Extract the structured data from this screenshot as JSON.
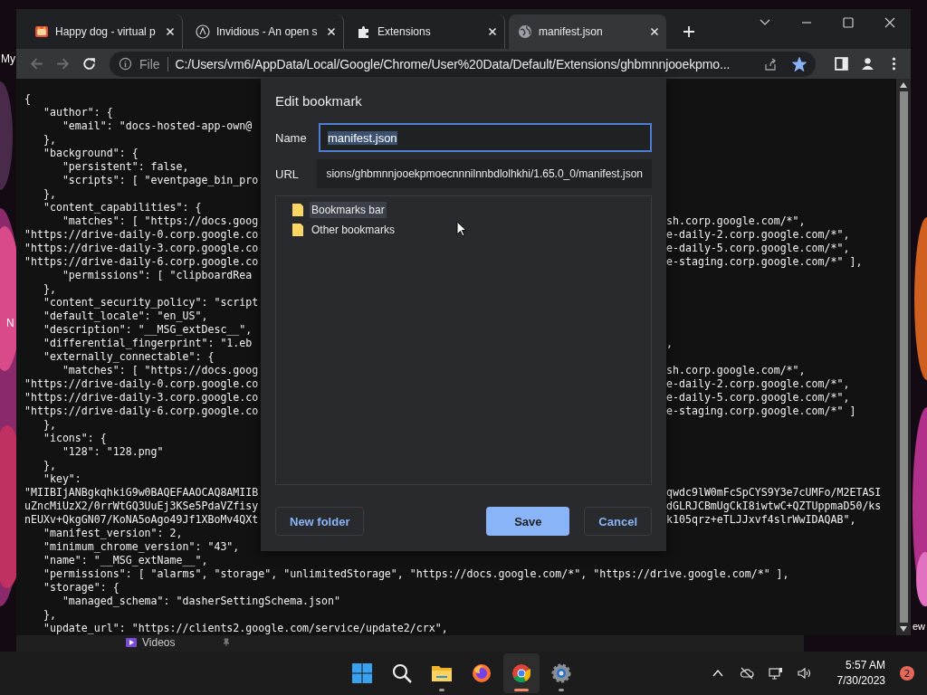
{
  "desktop_labels": [
    {
      "text": "My"
    },
    {
      "text": "N"
    },
    {
      "text": "ew"
    }
  ],
  "background_window": {
    "item": "Videos"
  },
  "tabs": [
    {
      "title": "Happy dog - virtual p",
      "selected": false
    },
    {
      "title": "Invidious - An open s",
      "selected": false
    },
    {
      "title": "Extensions",
      "selected": false
    },
    {
      "title": "manifest.json",
      "selected": true
    }
  ],
  "toolbar": {
    "back": {
      "disabled": true
    },
    "forward": {
      "disabled": true
    },
    "scheme": "File",
    "url": "C:/Users/vm6/AppData/Local/Google/Chrome/User%20Data/Default/Extensions/ghbmnnjooekpmo...",
    "bookmarked": true
  },
  "code_lines": [
    {
      "left": "{"
    },
    {
      "left": "   \"author\": {"
    },
    {
      "left": "      \"email\": \"docs-hosted-app-own@"
    },
    {
      "left": "   },"
    },
    {
      "left": "   \"background\": {"
    },
    {
      "left": "      \"persistent\": false,"
    },
    {
      "left": "      \"scripts\": [ \"eventpage_bin_pro"
    },
    {
      "left": "   },"
    },
    {
      "left": "   \"content_capabilities\": {"
    },
    {
      "left": "      \"matches\": [ \"https://docs.goog",
      "right": "sh.corp.google.com/*\","
    },
    {
      "left": "\"https://drive-daily-0.corp.google.co",
      "right": "e-daily-2.corp.google.com/*\","
    },
    {
      "left": "\"https://drive-daily-3.corp.google.co",
      "right": "e-daily-5.corp.google.com/*\","
    },
    {
      "left": "\"https://drive-daily-6.corp.google.co",
      "right": "e-staging.corp.google.com/*\" ],"
    },
    {
      "left": "      \"permissions\": [ \"clipboardRea"
    },
    {
      "left": "   },"
    },
    {
      "left": "   \"content_security_policy\": \"script"
    },
    {
      "left": "   \"default_locale\": \"en_US\","
    },
    {
      "left": "   \"description\": \"__MSG_extDesc__\","
    },
    {
      "left": "   \"differential_fingerprint\": \"1.eb",
      "right": ","
    },
    {
      "left": "   \"externally_connectable\": {"
    },
    {
      "left": "      \"matches\": [ \"https://docs.goog",
      "right": "sh.corp.google.com/*\","
    },
    {
      "left": "\"https://drive-daily-0.corp.google.co",
      "right": "e-daily-2.corp.google.com/*\","
    },
    {
      "left": "\"https://drive-daily-3.corp.google.co",
      "right": "e-daily-5.corp.google.com/*\","
    },
    {
      "left": "\"https://drive-daily-6.corp.google.co",
      "right": "e-staging.corp.google.com/*\" ]"
    },
    {
      "left": "   },"
    },
    {
      "left": "   \"icons\": {"
    },
    {
      "left": "      \"128\": \"128.png\""
    },
    {
      "left": "   },"
    },
    {
      "left": "   \"key\":"
    },
    {
      "left": "\"MIIBIjANBgkqhkiG9w0BAQEFAAOCAQ8AMIIB",
      "right": "qwdc9lW0mFcSpCYS9Y3e7cUMFo/M2ETASI"
    },
    {
      "left": "uZncMiUzX2/0rrWtGQ3UuEj3KSe5PdaVZfisy",
      "right": "dGLRJCBmUgCkI8iwtwC+QZTUppmaD50/ks"
    },
    {
      "left": "nEUXv+QkgGN07/KoNA5oAgo49Jf1XBoMv4QXt",
      "right": "k105qrz+eTLJJxvf4slrWwIDAQAB\","
    },
    {
      "left": "   \"manifest_version\": 2,"
    },
    {
      "left": "   \"minimum_chrome_version\": \"43\","
    },
    {
      "left": "   \"name\": \"__MSG_extName__\","
    },
    {
      "left": "   \"permissions\": [ \"alarms\", \"storage\", \"unlimitedStorage\", \"https://docs.google.com/*\", \"https://drive.google.com/*\" ],"
    },
    {
      "left": "   \"storage\": {"
    },
    {
      "left": "      \"managed_schema\": \"dasherSettingSchema.json\""
    },
    {
      "left": "   },"
    },
    {
      "left": "   \"update_url\": \"https://clients2.google.com/service/update2/crx\","
    }
  ],
  "dialog": {
    "title": "Edit bookmark",
    "name_label": "Name",
    "name_value": "manifest.json",
    "name_text_selected": true,
    "url_label": "URL",
    "url_value": "sions/ghbmnnjooekpmoecnnnilnnbdlolhkhi/1.65.0_0/manifest.json",
    "folders": [
      {
        "label": "Bookmarks bar",
        "selected": true
      },
      {
        "label": "Other bookmarks",
        "selected": false
      }
    ],
    "buttons": [
      {
        "label": "New folder",
        "kind": "secondary"
      },
      {
        "label": "Save",
        "kind": "primary"
      },
      {
        "label": "Cancel",
        "kind": "secondary"
      }
    ]
  },
  "taskbar": {
    "apps": [
      {
        "kind": "start",
        "running": false,
        "active": false
      },
      {
        "kind": "search",
        "running": false,
        "active": false
      },
      {
        "kind": "files",
        "running": true,
        "active": false
      },
      {
        "kind": "firefox",
        "running": false,
        "active": false
      },
      {
        "kind": "chrome",
        "running": true,
        "active": true
      },
      {
        "kind": "settings",
        "running": true,
        "active": false
      }
    ],
    "time": "5:57 AM",
    "date": "7/30/2023",
    "notification_count": "2"
  }
}
